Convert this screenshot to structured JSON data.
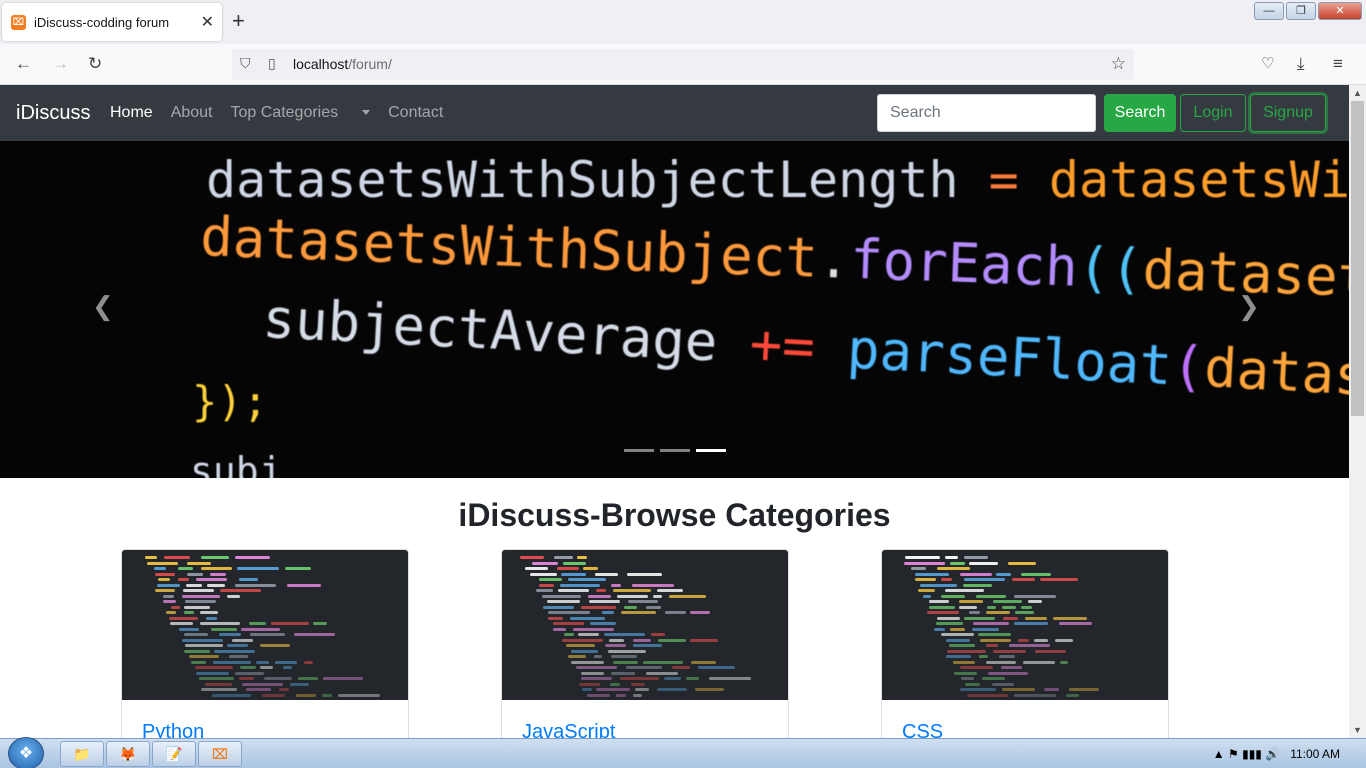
{
  "browser": {
    "tab_title": "iDiscuss-codding forum",
    "tab_close": "✕",
    "new_tab": "+",
    "url_host": "localhost",
    "url_path": "/forum/",
    "favicon_glyph": "⌧",
    "icons": [
      "back-icon",
      "forward-icon",
      "reload-icon",
      "shield-icon",
      "page-icon",
      "bookmark-star-icon",
      "pocket-icon",
      "download-icon",
      "menu-icon"
    ],
    "window_buttons": {
      "minimize": "—",
      "restore": "❐",
      "close": "✕"
    }
  },
  "site": {
    "brand": "iDiscuss",
    "nav": {
      "home": "Home",
      "about": "About",
      "top_categories": "Top Categories",
      "contact": "Contact"
    },
    "search_placeholder": "Search",
    "search_button": "Search",
    "login_button": "Login",
    "signup_button": "Signup",
    "accent_color": "#28a745",
    "navbar_color": "#343a40"
  },
  "carousel": {
    "code_lines": [
      {
        "a": "datasetsWithSubjectLength",
        "b": " = ",
        "c": "datasetsWithSu"
      },
      {
        "a": "datasetsWithSubject",
        "b": ".",
        "c": "forEach",
        "d": "((",
        "e": "dataset",
        "f": ") =>",
        "g": " {"
      },
      {
        "a": "subjectAverage",
        "b": " += ",
        "c": "parseFloat",
        "d": "(",
        "e": "dataset",
        "f": "[\""
      },
      {
        "a": "});"
      },
      {
        "a": "subj"
      }
    ],
    "prev_glyph": "❮",
    "next_glyph": "❯",
    "slide_count": 3,
    "active_slide": 3
  },
  "heading": "iDiscuss-Browse Categories",
  "categories": [
    {
      "title": "Python"
    },
    {
      "title": "JavaScript"
    },
    {
      "title": "CSS"
    }
  ],
  "taskbar": {
    "start_glyph": "❖",
    "apps": [
      "📁",
      "🦊",
      "📝",
      "⌧"
    ],
    "clock": "11:00 AM",
    "tray_icons": "▲  ⚑  ▮▮▮  🔊"
  }
}
